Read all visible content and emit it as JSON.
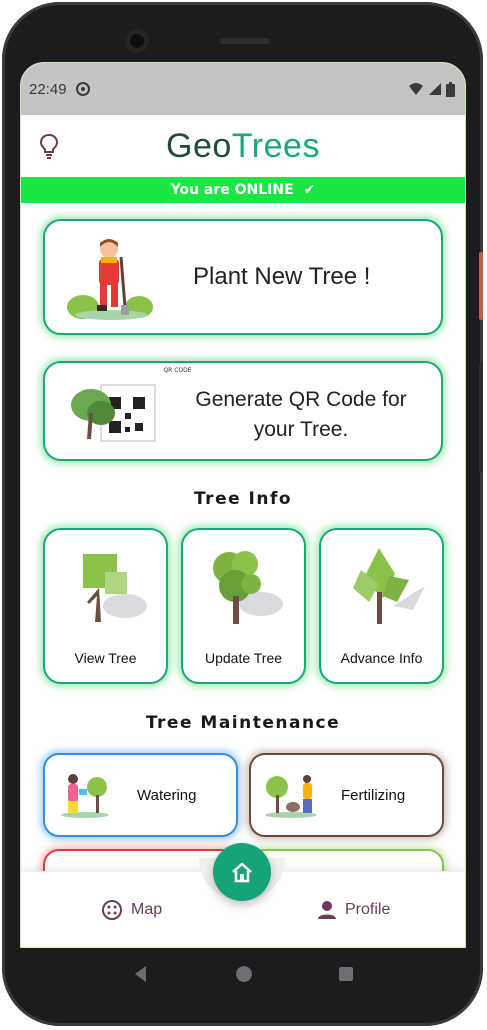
{
  "status_bar": {
    "time": "22:49"
  },
  "header": {
    "title_part1": "Geo",
    "title_part2": "Trees"
  },
  "connection": {
    "status": "You are ONLINE"
  },
  "actions": {
    "plant": "Plant New Tree !",
    "qr_line1": "Generate QR Code for",
    "qr_line2": "your Tree.",
    "qr_caption": "QR CODE"
  },
  "tree_info": {
    "title": "Tree Info",
    "items": [
      {
        "label": "View Tree"
      },
      {
        "label": "Update Tree"
      },
      {
        "label": "Advance Info"
      }
    ]
  },
  "tree_maintenance": {
    "title": "Tree Maintenance",
    "items": [
      {
        "label": "Watering",
        "border": "#2f8fe6"
      },
      {
        "label": "Fertilizing",
        "border": "#6b4a3a"
      }
    ]
  },
  "bottom_nav": {
    "map": "Map",
    "profile": "Profile"
  },
  "colors": {
    "accent": "#1aa87a",
    "online": "#18e645",
    "nav": "#6b3a5c"
  }
}
